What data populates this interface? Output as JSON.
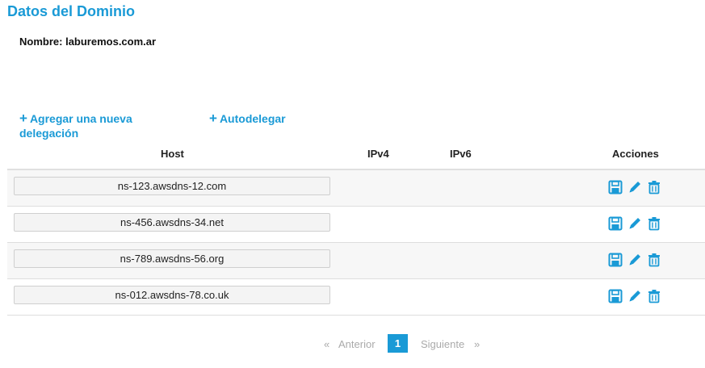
{
  "page": {
    "title": "Datos del Dominio"
  },
  "domain": {
    "label": "Nombre:",
    "value": "laburemos.com.ar"
  },
  "actions_links": {
    "add_delegation": "Agregar una nueva delegación",
    "autodelegate": "Autodelegar"
  },
  "table": {
    "headers": {
      "host": "Host",
      "ipv4": "IPv4",
      "ipv6": "IPv6",
      "actions": "Acciones"
    },
    "rows": [
      {
        "host": "ns-123.awsdns-12.com",
        "ipv4": "",
        "ipv6": ""
      },
      {
        "host": "ns-456.awsdns-34.net",
        "ipv4": "",
        "ipv6": ""
      },
      {
        "host": "ns-789.awsdns-56.org",
        "ipv4": "",
        "ipv6": ""
      },
      {
        "host": "ns-012.awsdns-78.co.uk",
        "ipv4": "",
        "ipv6": ""
      }
    ],
    "row_actions": [
      "save-icon",
      "edit-icon",
      "trash-icon"
    ]
  },
  "pagination": {
    "prev_arrow": "«",
    "prev": "Anterior",
    "current": "1",
    "next": "Siguiente",
    "next_arrow": "»"
  },
  "colors": {
    "accent": "#1a9ad6",
    "row_alt": "#f7f7f7"
  }
}
